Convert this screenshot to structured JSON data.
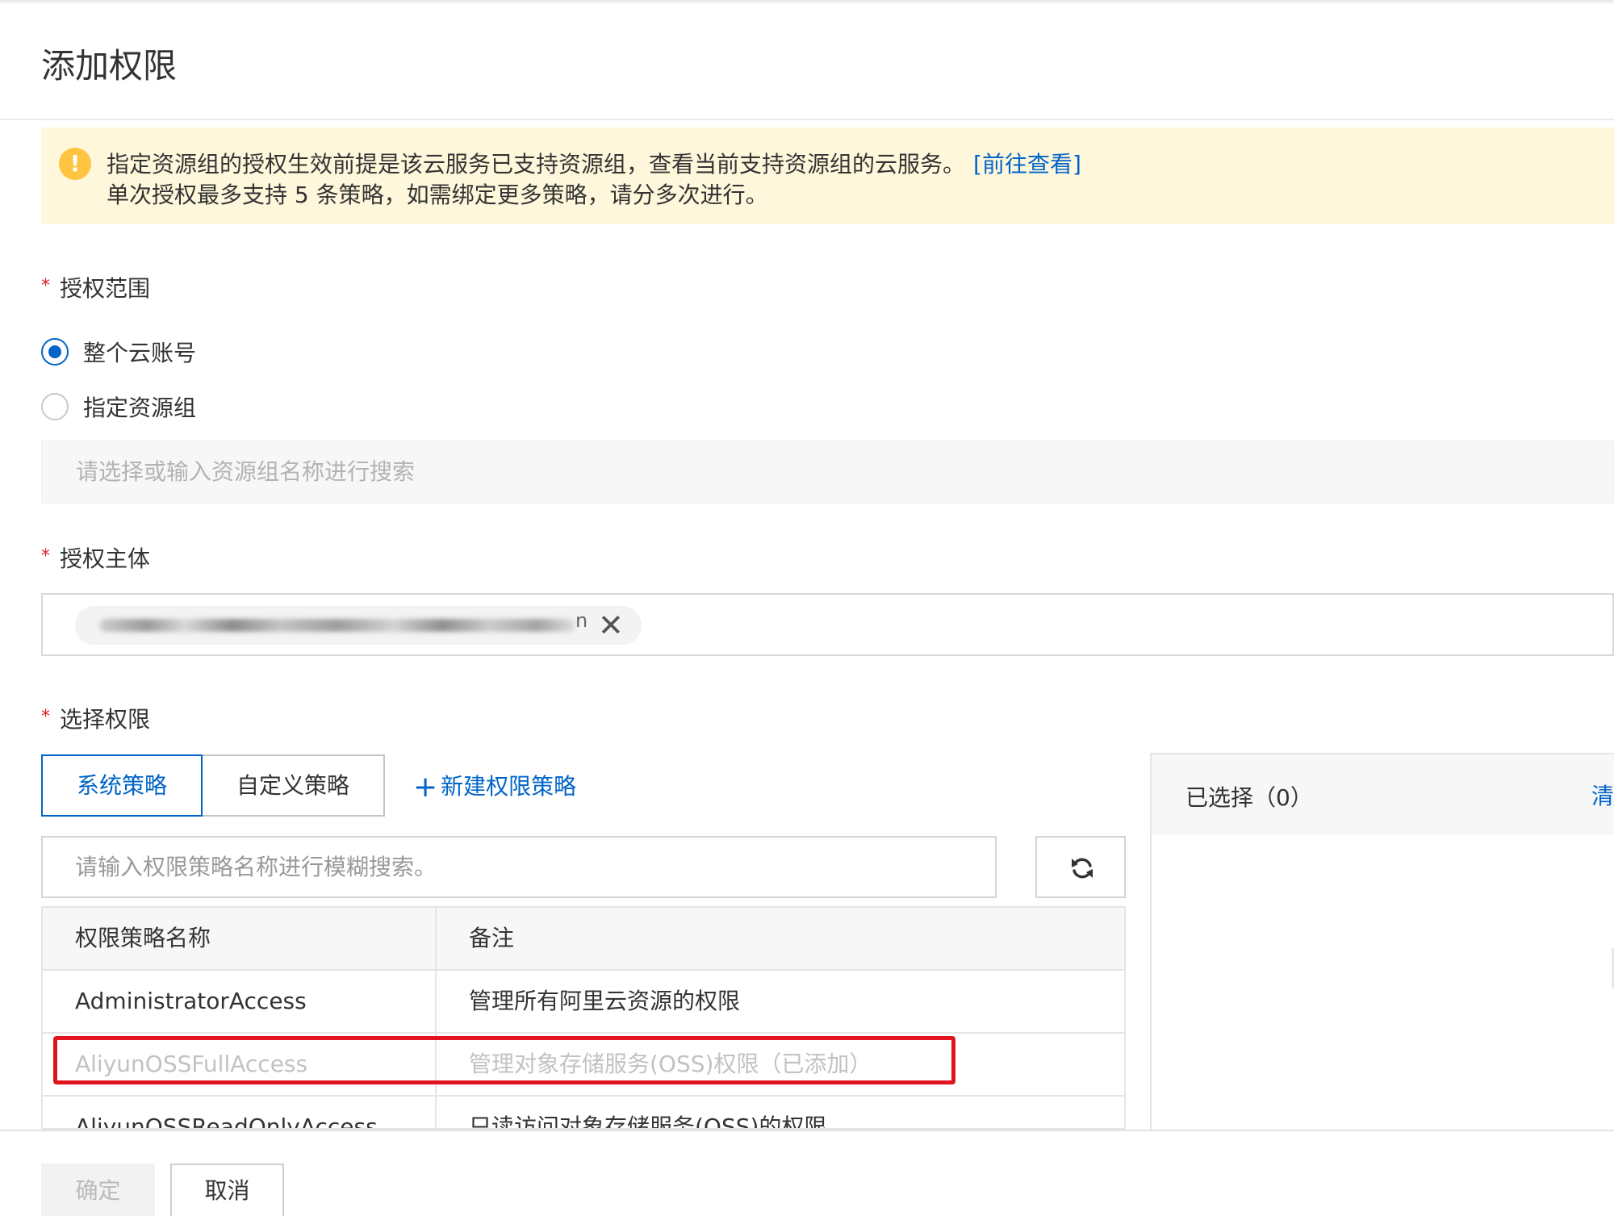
{
  "header": {
    "title": "添加权限"
  },
  "notice": {
    "line1": "指定资源组的授权生效前提是该云服务已支持资源组，查看当前支持资源组的云服务。",
    "link": "[前往查看]",
    "line2": "单次授权最多支持 5 条策略，如需绑定更多策略，请分多次进行。",
    "icon": "warning-icon"
  },
  "scope": {
    "label": "授权范围",
    "options": [
      {
        "label": "整个云账号",
        "checked": true
      },
      {
        "label": "指定资源组",
        "checked": false
      }
    ],
    "resource_group_placeholder": "请选择或输入资源组名称进行搜索"
  },
  "principal": {
    "label": "授权主体",
    "tag_tail": "n",
    "close_glyph": "✕"
  },
  "permissions": {
    "label": "选择权限",
    "tabs": [
      {
        "label": "系统策略",
        "active": true
      },
      {
        "label": "自定义策略",
        "active": false
      }
    ],
    "new_policy": {
      "plus": "+",
      "label": "新建权限策略"
    },
    "search_placeholder": "请输入权限策略名称进行模糊搜索。",
    "table": {
      "columns": [
        "权限策略名称",
        "备注"
      ],
      "rows": [
        {
          "name": "AdministratorAccess",
          "note": "管理所有阿里云资源的权限",
          "disabled": false
        },
        {
          "name": "AliyunOSSFullAccess",
          "note": "管理对象存储服务(OSS)权限（已添加）",
          "disabled": true
        },
        {
          "name": "AliyunOSSReadOnlyAccess",
          "note": "只读访问对象存储服务(OSS)的权限",
          "disabled": false
        }
      ]
    }
  },
  "selected": {
    "title": "已选择（0）",
    "clear": "清"
  },
  "footer": {
    "ok": "确定",
    "cancel": "取消"
  },
  "colors": {
    "primary": "#0064c8",
    "warning_bg": "#fff7db",
    "warning_icon": "#ffc440",
    "highlight": "#e0131f"
  }
}
